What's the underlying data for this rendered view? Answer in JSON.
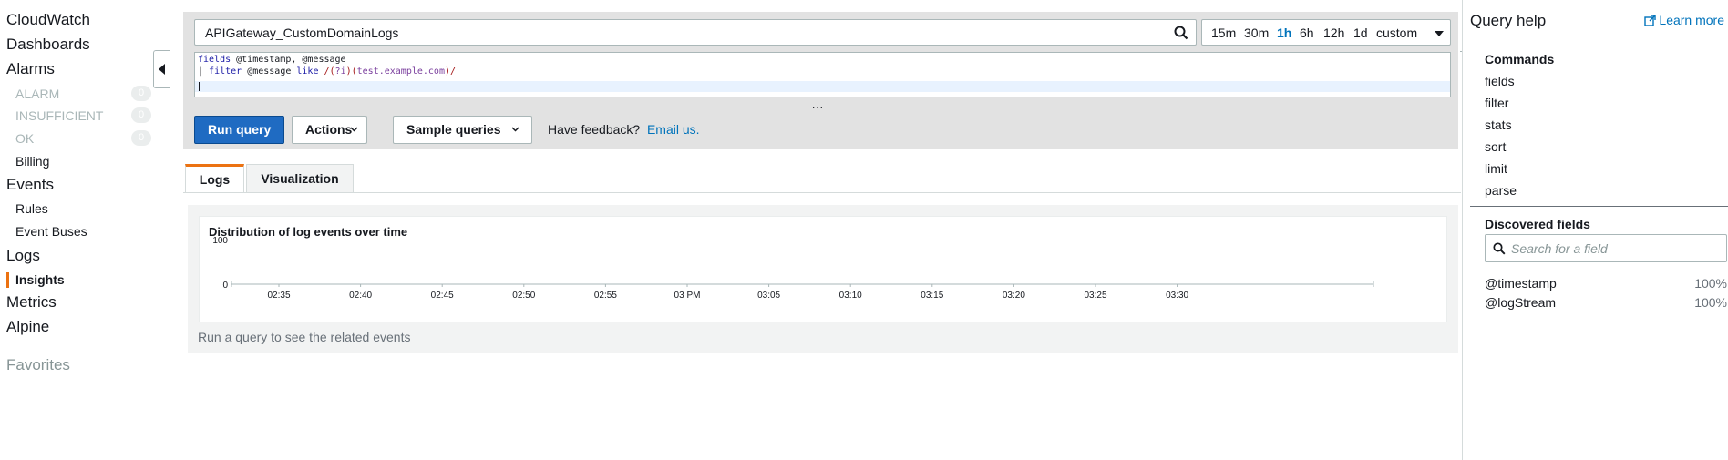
{
  "nav": {
    "items": [
      {
        "label": "CloudWatch"
      },
      {
        "label": "Dashboards"
      },
      {
        "label": "Alarms"
      },
      {
        "label": "Events"
      },
      {
        "label": "Logs"
      },
      {
        "label": "Metrics"
      },
      {
        "label": "Alpine"
      }
    ],
    "alarm_states": [
      {
        "label": "ALARM",
        "count": "0"
      },
      {
        "label": "INSUFFICIENT",
        "count": "0"
      },
      {
        "label": "OK",
        "count": "0"
      }
    ],
    "billing": "Billing",
    "rules": "Rules",
    "event_buses": "Event Buses",
    "insights": "Insights",
    "favorites": "Favorites"
  },
  "query": {
    "log_group": "APIGateway_CustomDomainLogs",
    "time_ranges": [
      "15m",
      "30m",
      "1h",
      "6h",
      "12h",
      "1d",
      "custom"
    ],
    "selected_time_range": "1h",
    "code_line1_kw": "fields",
    "code_line1_rest": " @timestamp, @message",
    "code_line2_pipe": "| ",
    "code_line2_kw": "filter",
    "code_line2_field": " @message ",
    "code_line2_like": "like",
    "code_line2_re_open": " /(",
    "code_line2_flag": "?i",
    "code_line2_re_mid": ")(",
    "code_line2_host": "test.example.com",
    "code_line2_re_close": ")/",
    "resize_handle": "...",
    "run_label": "Run query",
    "actions_label": "Actions",
    "samples_label": "Sample queries",
    "feedback_text": "Have feedback?",
    "feedback_link": "Email us."
  },
  "tabs": [
    {
      "label": "Logs",
      "active": true
    },
    {
      "label": "Visualization",
      "active": false
    }
  ],
  "results": {
    "chart_title": "Distribution of log events over time",
    "empty_message": "Run a query to see the related events"
  },
  "chart_data": {
    "type": "bar",
    "title": "Distribution of log events over time",
    "xlabel": "",
    "ylabel": "",
    "categories": [
      "02:35",
      "02:40",
      "02:45",
      "02:50",
      "02:55",
      "03 PM",
      "03:05",
      "03:10",
      "03:15",
      "03:20",
      "03:25",
      "03:30"
    ],
    "y_ticks": [
      "100",
      "0"
    ],
    "values": [],
    "ylim": [
      0,
      100
    ],
    "grid": false
  },
  "help": {
    "title": "Query help",
    "learn_more": "Learn more",
    "commands_heading": "Commands",
    "commands": [
      "fields",
      "filter",
      "stats",
      "sort",
      "limit",
      "parse"
    ],
    "discovered_heading": "Discovered fields",
    "search_placeholder": "Search for a field",
    "fields": [
      {
        "name": "@timestamp",
        "pct": "100%"
      },
      {
        "name": "@logStream",
        "pct": "100%"
      }
    ]
  },
  "colors": {
    "accent": "#ec7211",
    "primary_button": "#1f6bc2",
    "link": "#0073bb"
  }
}
